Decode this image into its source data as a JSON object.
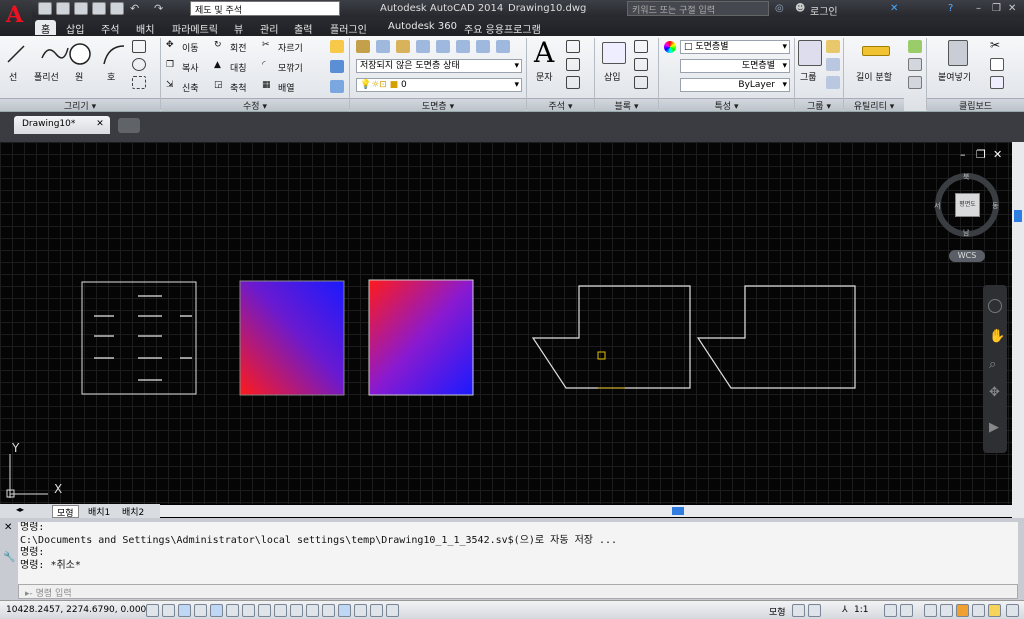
{
  "title": {
    "app": "Autodesk AutoCAD 2014",
    "file": "Drawing10.dwg",
    "workspace": "제도 및 주석",
    "search_placeholder": "키워드 또는 구절 입력",
    "login": "로그인"
  },
  "tabs": [
    "홈",
    "삽입",
    "주석",
    "배치",
    "파라메트릭",
    "뷰",
    "관리",
    "출력",
    "플러그인",
    "Autodesk 360",
    "주요 응용프로그램"
  ],
  "ribbon": {
    "draw": {
      "title": "그리기",
      "tools": [
        "선",
        "폴리선",
        "원",
        "호"
      ]
    },
    "modify": {
      "title": "수정",
      "tools": [
        "이동",
        "회전",
        "자르기",
        "복사",
        "대칭",
        "모깎기",
        "신축",
        "축척",
        "배열"
      ]
    },
    "layers": {
      "title": "도면층",
      "state": "저장되지 않은 도면층 상태",
      "current": "0"
    },
    "annotation": {
      "title": "주석",
      "text": "문자"
    },
    "block": {
      "title": "블록",
      "insert": "삽입"
    },
    "properties": {
      "title": "특성",
      "color": "도면층별",
      "linetype": "도면층별",
      "lineweight": "ByLayer"
    },
    "groups": {
      "title": "그룹",
      "group": "그룹"
    },
    "utilities": {
      "title": "유틸리티",
      "measure": "길이 분할"
    },
    "clipboard": {
      "title": "클립보드",
      "paste": "붙여넣기"
    }
  },
  "doc_tab": "Drawing10*",
  "viewcube": {
    "north": "북",
    "south": "남",
    "east": "동",
    "west": "서",
    "top": "평면도",
    "wcs": "WCS"
  },
  "ucs": {
    "x": "X",
    "y": "Y"
  },
  "layout_tabs": [
    "모형",
    "배치1",
    "배치2"
  ],
  "command_history": [
    "명령:",
    "C:\\Documents and Settings\\Administrator\\local settings\\temp\\Drawing10_1_1_3542.sv$(으)로 자동 저장 ...",
    "명령:",
    "명령: *취소*"
  ],
  "command_placeholder": "명령 입력",
  "status": {
    "coords": "10428.2457, 2274.6790, 0.0000",
    "model": "모형",
    "scale": "1:1"
  },
  "colors": {
    "gradient_red": "#ff1a1a",
    "gradient_blue": "#1a1aff",
    "accent": "#e12"
  }
}
